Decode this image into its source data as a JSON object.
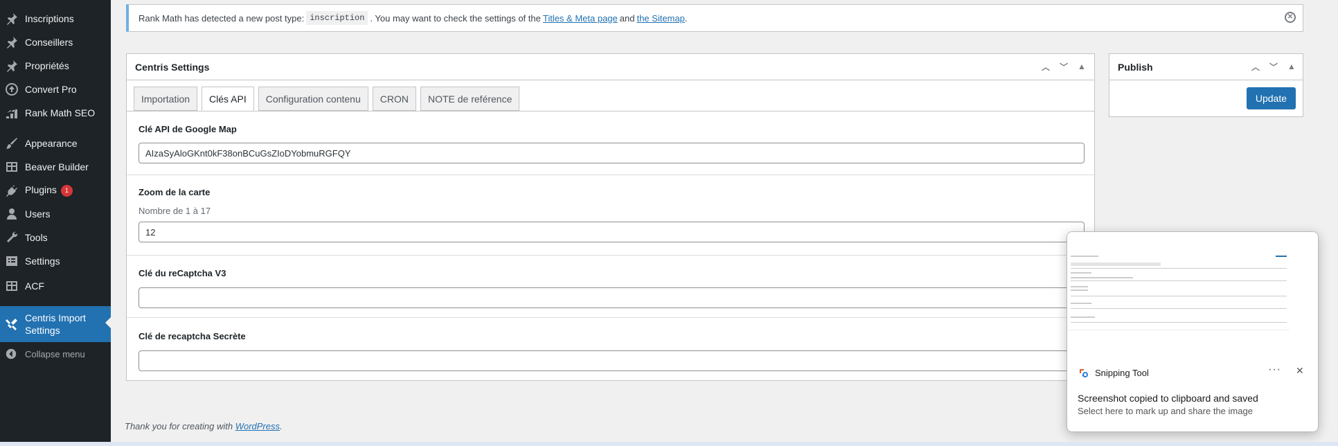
{
  "sidebar": {
    "items": [
      {
        "label": "Inscriptions",
        "icon": "pin-icon"
      },
      {
        "label": "Conseillers",
        "icon": "pin-icon"
      },
      {
        "label": "Propriétés",
        "icon": "pin-icon"
      },
      {
        "label": "Convert Pro",
        "icon": "convert-pro-icon"
      },
      {
        "label": "Rank Math SEO",
        "icon": "rank-math-icon"
      },
      {
        "label": "Appearance",
        "icon": "brush-icon"
      },
      {
        "label": "Beaver Builder",
        "icon": "grid-icon"
      },
      {
        "label": "Plugins",
        "icon": "plug-icon",
        "badge": "1"
      },
      {
        "label": "Users",
        "icon": "user-icon"
      },
      {
        "label": "Tools",
        "icon": "wrench-icon"
      },
      {
        "label": "Settings",
        "icon": "settings-icon"
      },
      {
        "label": "ACF",
        "icon": "grid-icon"
      }
    ],
    "active_label": "Centris Import Settings",
    "collapse_label": "Collapse menu"
  },
  "notice": {
    "text_before": "Rank Math has detected a new post type:",
    "code": "inscription",
    "text_mid": ". You may want to check the settings of the",
    "link1": "Titles & Meta page",
    "text_and": "and",
    "link2": "the Sitemap",
    "text_end": "."
  },
  "settings": {
    "title": "Centris Settings",
    "tabs": [
      "Importation",
      "Clés API",
      "Configuration contenu",
      "CRON",
      "NOTE de reférence"
    ],
    "active_tab": "Clés API",
    "fields": {
      "google_map": {
        "label": "Clé API de Google Map",
        "value": "AIzaSyAloGKnt0kF38onBCuGsZIoDYobmuRGFQY"
      },
      "zoom": {
        "label": "Zoom de la carte",
        "description": "Nombre de 1 à 17",
        "value": "12"
      },
      "recaptcha": {
        "label": "Clé du reCaptcha V3",
        "value": ""
      },
      "recaptcha_secret": {
        "label": "Clé de recaptcha Secrète",
        "value": ""
      }
    }
  },
  "publish": {
    "title": "Publish",
    "update_label": "Update"
  },
  "footer": {
    "text": "Thank you for creating with",
    "link": "WordPress",
    "end": "."
  },
  "toast": {
    "app_name": "Snipping Tool",
    "more": "···",
    "message": "Screenshot copied to clipboard and saved",
    "sub": "Select here to mark up and share the image"
  },
  "colors": {
    "sidebar_bg": "#1d2327",
    "accent": "#2271b1",
    "badge": "#d63638",
    "notice_border": "#72aee6"
  }
}
